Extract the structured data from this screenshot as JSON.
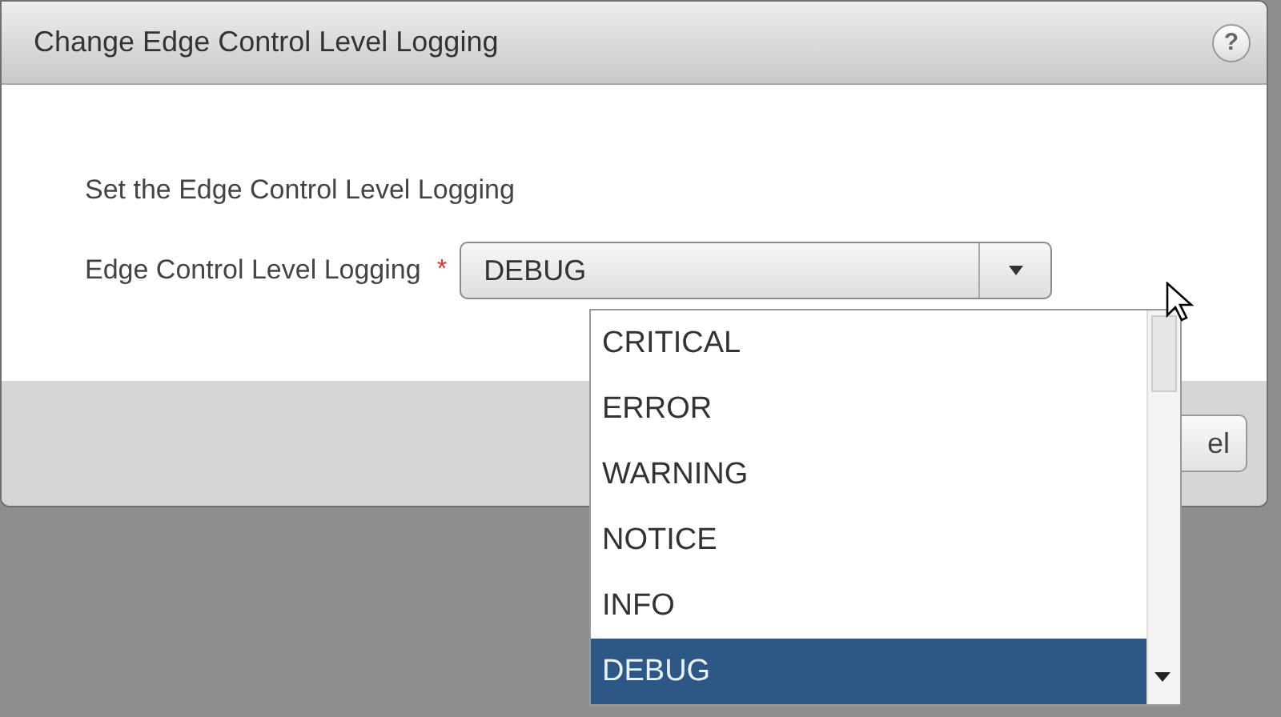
{
  "dialog": {
    "title": "Change Edge Control Level Logging",
    "help": "?"
  },
  "instruction": "Set the Edge Control Level Logging",
  "field": {
    "label": "Edge Control Level Logging",
    "required_mark": "*",
    "value": "DEBUG",
    "expanded": true
  },
  "options": [
    {
      "label": "CRITICAL",
      "selected": false
    },
    {
      "label": "ERROR",
      "selected": false
    },
    {
      "label": "WARNING",
      "selected": false
    },
    {
      "label": "NOTICE",
      "selected": false
    },
    {
      "label": "INFO",
      "selected": false
    },
    {
      "label": "DEBUG",
      "selected": true
    }
  ],
  "footer_button": "el"
}
